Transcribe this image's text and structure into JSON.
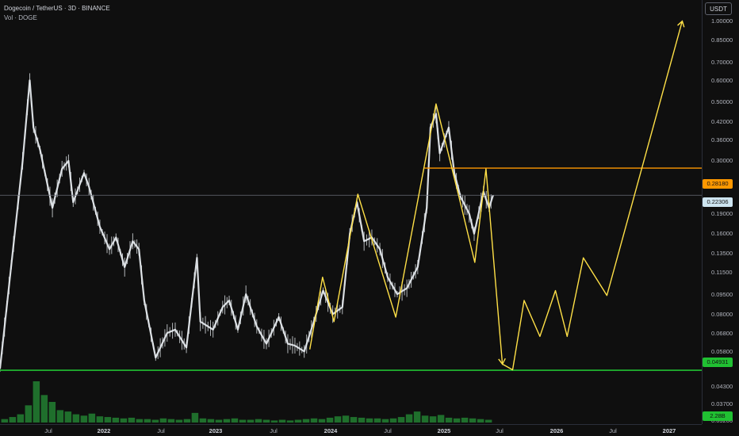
{
  "header": {
    "symbol_line": "Dogecoin / TetherUS · 3D · BINANCE",
    "volume_line": "Vol · DOGE"
  },
  "currency_button": "USDT",
  "colors": {
    "background": "#0f0f0f",
    "candle": "#e9eef2",
    "projection": "#ffe047",
    "resistance": "#ff9800",
    "support": "#20c032",
    "volume": "#1f6f2c"
  },
  "price_axis": {
    "ticks": [
      "1.00000",
      "0.85000",
      "0.70000",
      "0.60000",
      "0.50000",
      "0.42000",
      "0.36000",
      "0.30000",
      "0.25000",
      "0.22306",
      "0.19000",
      "0.16000",
      "0.13500",
      "0.11500",
      "0.09500",
      "0.08000",
      "0.06800",
      "0.05800",
      "0.04931",
      "0.04300",
      "0.03700",
      "0.03200"
    ]
  },
  "time_axis": {
    "labels": [
      {
        "text": "Jul",
        "year": false
      },
      {
        "text": "2022",
        "year": true
      },
      {
        "text": "Jul",
        "year": false
      },
      {
        "text": "2023",
        "year": true
      },
      {
        "text": "Jul",
        "year": false
      },
      {
        "text": "2024",
        "year": true
      },
      {
        "text": "Jul",
        "year": false
      },
      {
        "text": "2025",
        "year": true
      },
      {
        "text": "Jul",
        "year": false
      },
      {
        "text": "2026",
        "year": true
      },
      {
        "text": "Jul",
        "year": false
      },
      {
        "text": "2027",
        "year": true
      }
    ]
  },
  "price_tags": {
    "resistance": "0.28180",
    "last": "0.22306",
    "support": "0.04931",
    "volume": "2.28B"
  },
  "chart_data": {
    "type": "line",
    "scale": "log",
    "ylim": [
      0.031,
      1.2
    ],
    "xlim": [
      "2021-02",
      "2027-04"
    ],
    "price": [
      {
        "x": "2021-02",
        "y": 0.05
      },
      {
        "x": "2021-04-15",
        "y": 0.3
      },
      {
        "x": "2021-05-08",
        "y": 0.6
      },
      {
        "x": "2021-05-20",
        "y": 0.4
      },
      {
        "x": "2021-06-10",
        "y": 0.33
      },
      {
        "x": "2021-07-20",
        "y": 0.2
      },
      {
        "x": "2021-08-20",
        "y": 0.28
      },
      {
        "x": "2021-09-10",
        "y": 0.3
      },
      {
        "x": "2021-09-25",
        "y": 0.21
      },
      {
        "x": "2021-10-30",
        "y": 0.27
      },
      {
        "x": "2021-11-15",
        "y": 0.24
      },
      {
        "x": "2021-12-20",
        "y": 0.17
      },
      {
        "x": "2022-01-20",
        "y": 0.14
      },
      {
        "x": "2022-02-10",
        "y": 0.155
      },
      {
        "x": "2022-03-10",
        "y": 0.12
      },
      {
        "x": "2022-04-05",
        "y": 0.15
      },
      {
        "x": "2022-04-25",
        "y": 0.14
      },
      {
        "x": "2022-05-12",
        "y": 0.09
      },
      {
        "x": "2022-06-18",
        "y": 0.055
      },
      {
        "x": "2022-07-25",
        "y": 0.068
      },
      {
        "x": "2022-08-20",
        "y": 0.07
      },
      {
        "x": "2022-09-25",
        "y": 0.06
      },
      {
        "x": "2022-10-29",
        "y": 0.13
      },
      {
        "x": "2022-11-09",
        "y": 0.075
      },
      {
        "x": "2022-12-20",
        "y": 0.07
      },
      {
        "x": "2023-01-20",
        "y": 0.085
      },
      {
        "x": "2023-02-10",
        "y": 0.09
      },
      {
        "x": "2023-03-10",
        "y": 0.07
      },
      {
        "x": "2023-04-05",
        "y": 0.095
      },
      {
        "x": "2023-05-10",
        "y": 0.072
      },
      {
        "x": "2023-06-10",
        "y": 0.062
      },
      {
        "x": "2023-07-20",
        "y": 0.078
      },
      {
        "x": "2023-08-18",
        "y": 0.062
      },
      {
        "x": "2023-09-10",
        "y": 0.061
      },
      {
        "x": "2023-10-10",
        "y": 0.058
      },
      {
        "x": "2023-11-10",
        "y": 0.075
      },
      {
        "x": "2023-12-10",
        "y": 0.098
      },
      {
        "x": "2024-01-10",
        "y": 0.08
      },
      {
        "x": "2024-02-10",
        "y": 0.085
      },
      {
        "x": "2024-03-05",
        "y": 0.16
      },
      {
        "x": "2024-03-28",
        "y": 0.21
      },
      {
        "x": "2024-04-20",
        "y": 0.15
      },
      {
        "x": "2024-05-15",
        "y": 0.155
      },
      {
        "x": "2024-06-10",
        "y": 0.14
      },
      {
        "x": "2024-07-05",
        "y": 0.11
      },
      {
        "x": "2024-08-05",
        "y": 0.095
      },
      {
        "x": "2024-09-05",
        "y": 0.1
      },
      {
        "x": "2024-10-10",
        "y": 0.12
      },
      {
        "x": "2024-11-08",
        "y": 0.2
      },
      {
        "x": "2024-11-20",
        "y": 0.4
      },
      {
        "x": "2024-12-08",
        "y": 0.45
      },
      {
        "x": "2024-12-20",
        "y": 0.32
      },
      {
        "x": "2025-01-18",
        "y": 0.4
      },
      {
        "x": "2025-02-05",
        "y": 0.27
      },
      {
        "x": "2025-02-25",
        "y": 0.22
      },
      {
        "x": "2025-03-25",
        "y": 0.19
      },
      {
        "x": "2025-04-10",
        "y": 0.16
      },
      {
        "x": "2025-05-10",
        "y": 0.23
      },
      {
        "x": "2025-05-28",
        "y": 0.2
      },
      {
        "x": "2025-06-10",
        "y": 0.22306
      }
    ],
    "projection": [
      {
        "x": "2023-10-28",
        "y": 0.059
      },
      {
        "x": "2023-12-08",
        "y": 0.11
      },
      {
        "x": "2024-01-14",
        "y": 0.075
      },
      {
        "x": "2024-03-31",
        "y": 0.225
      },
      {
        "x": "2024-07-31",
        "y": 0.078
      },
      {
        "x": "2024-12-08",
        "y": 0.49
      },
      {
        "x": "2025-02-20",
        "y": 0.22
      },
      {
        "x": "2025-04-12",
        "y": 0.125
      },
      {
        "x": "2025-05-18",
        "y": 0.28
      },
      {
        "x": "2025-07-10",
        "y": 0.052
      },
      {
        "x": "2025-08-12",
        "y": 0.0495
      },
      {
        "x": "2025-09-18",
        "y": 0.09
      },
      {
        "x": "2025-11-08",
        "y": 0.066
      },
      {
        "x": "2025-12-28",
        "y": 0.098
      },
      {
        "x": "2026-02-04",
        "y": 0.066
      },
      {
        "x": "2026-03-28",
        "y": 0.13
      },
      {
        "x": "2026-06-12",
        "y": 0.094
      },
      {
        "x": "2027-02-10",
        "y": 1.0
      }
    ],
    "levels": {
      "resistance": 0.2818,
      "last": 0.22306,
      "support": 0.04931
    },
    "volume": {
      "series_max": 6.0,
      "values": [
        0.5,
        0.8,
        1.2,
        2.5,
        6.0,
        4.0,
        3.0,
        1.8,
        1.6,
        1.2,
        1.0,
        1.3,
        0.9,
        0.8,
        0.7,
        0.6,
        0.7,
        0.5,
        0.5,
        0.4,
        0.6,
        0.5,
        0.4,
        0.5,
        1.4,
        0.6,
        0.5,
        0.4,
        0.5,
        0.6,
        0.4,
        0.4,
        0.5,
        0.4,
        0.3,
        0.4,
        0.3,
        0.4,
        0.5,
        0.6,
        0.5,
        0.7,
        0.9,
        1.0,
        0.8,
        0.7,
        0.6,
        0.6,
        0.5,
        0.6,
        0.8,
        1.2,
        1.6,
        1.0,
        0.9,
        1.1,
        0.7,
        0.6,
        0.7,
        0.6,
        0.5,
        0.4
      ],
      "last": 2.28
    }
  }
}
